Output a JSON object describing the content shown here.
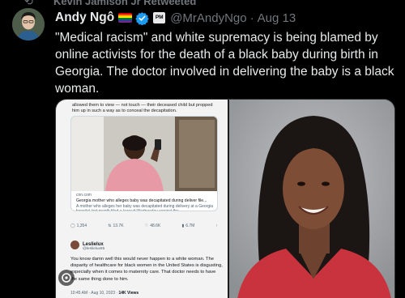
{
  "retweet": {
    "icon": "retweet-icon",
    "text": "Kevin Jamison Jr Retweeted"
  },
  "tweet": {
    "author_name": "Andy Ngô",
    "handle": "@MrAndyNgo",
    "separator": "·",
    "date": "Aug 13",
    "affiliate_badge": "PM",
    "text": "\"Medical racism\" and white supremacy is being blamed by online activists for the death of a black baby during birth in Georgia. The doctor involved in delivering the baby is a black woman."
  },
  "embedded_screenshot": {
    "top_text": "allowed them to view — not touch — their deceased child but propped him up in such a way as to conceal the decapitation.",
    "card": {
      "domain": "cnn.com",
      "headline": "Georgia mother who alleges baby was decapitated during deliver file...",
      "snippet": "A mother who alleges her baby was decapitated during delivery at a Georgia hospital last month filed a lawsuit Wednesday against the..."
    },
    "metrics": {
      "replies": "1,354",
      "reposts": "13.7K",
      "likes": "48.6K",
      "views": "6.7M"
    },
    "quote_user": {
      "name": "Leslielux",
      "handle": "@leslielux85"
    },
    "quote_text": "You know damn well this would never happen to a white woman. The disparity of healthcare for black women in the United States is disgusting, especially when it comes to maternity care. That doctor needs to have the same thing done to him.",
    "footer_time": "10:45 AM · Aug 10, 2023 ·",
    "footer_views": "14K Views"
  },
  "colors": {
    "background": "#000000",
    "text_primary": "#e7e9ea",
    "text_secondary": "#71767b",
    "verified_blue": "#1d9bf0",
    "border": "#2f3336"
  }
}
